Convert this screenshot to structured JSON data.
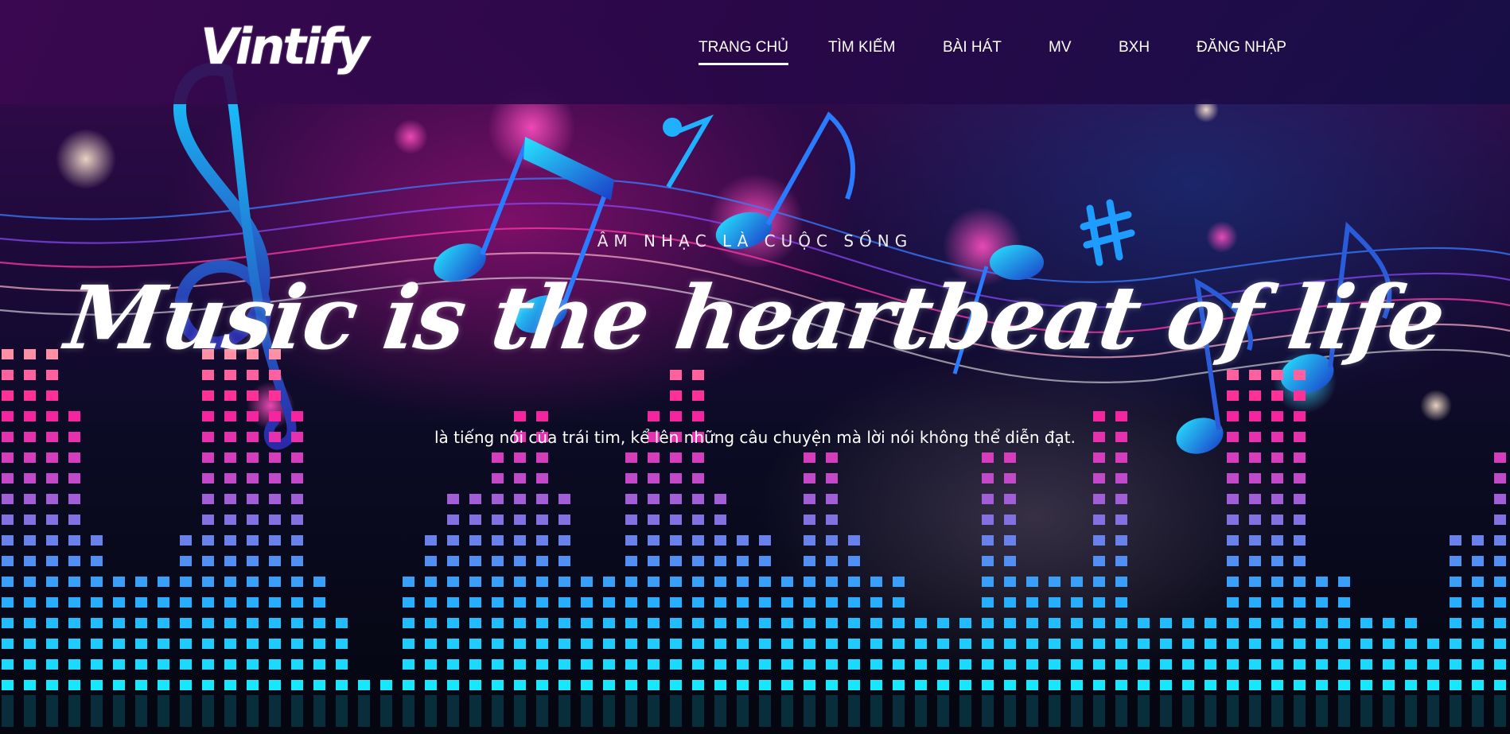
{
  "header": {
    "logo": "Vintify",
    "nav": [
      {
        "label": "TRANG CHỦ",
        "active": true
      },
      {
        "label": "TÌM KIẾM",
        "active": false
      },
      {
        "label": "BÀI HÁT",
        "active": false
      },
      {
        "label": "MV",
        "active": false
      },
      {
        "label": "BXH",
        "active": false
      },
      {
        "label": "ĐĂNG NHẬP",
        "active": false
      }
    ]
  },
  "hero": {
    "eyebrow": "ÂM NHẠC LÀ CUỘC SỐNG",
    "headline": "Music is the heartbeat of life",
    "subline": "là tiếng nói của trái tim, kể lên những câu chuyện mà lời nói không thể diễn đạt."
  },
  "theme": {
    "accent_pink": "#ff1f9e",
    "accent_cyan": "#18e4ff",
    "accent_blue": "#2a7bff",
    "header_bg": "#2a0a4a"
  },
  "icons": [
    "treble-clef-icon",
    "eighth-note-icon",
    "beamed-notes-icon",
    "sharp-icon"
  ]
}
